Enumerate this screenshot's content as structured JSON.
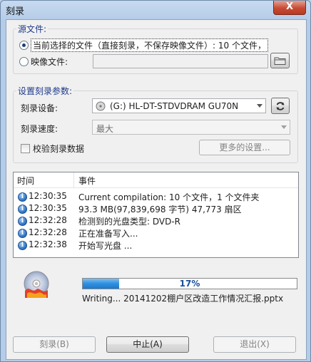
{
  "window": {
    "title": "刻录",
    "close_label": "X"
  },
  "source_group": {
    "title": "源文件:",
    "option_current_label": "当前选择的文件（直接刻录，不保存映像文件）: 10 个文件，",
    "option_image_label": "映像文件:",
    "image_path_value": ""
  },
  "params_group": {
    "title": "设置刻录参数:",
    "device_label": "刻录设备:",
    "device_value": "(G:) HL-DT-STDVDRAM GU70N",
    "speed_label": "刻录速度:",
    "speed_value": "最大",
    "verify_label": "校验刻录数据",
    "more_settings_label": "更多的设置..."
  },
  "log": {
    "columns": [
      "时间",
      "事件"
    ],
    "rows": [
      {
        "time": "12:30:35",
        "event": "Current compilation: 10 个文件，1 个文件夹"
      },
      {
        "time": "12:30:35",
        "event": "93.3 MB(97,839,698 字节)  47,773 扇区"
      },
      {
        "time": "12:32:28",
        "event": "检测到的光盘类型:  DVD-R"
      },
      {
        "time": "12:32:28",
        "event": "正在准备写入..."
      },
      {
        "time": "12:32:38",
        "event": "开始写光盘 ..."
      }
    ]
  },
  "progress": {
    "value": 0.17,
    "label": "17%",
    "status_text": "Writing... 20141202棚户区改造工作情况汇报.pptx"
  },
  "buttons": {
    "burn": "刻录(B)",
    "abort": "中止(A)",
    "exit": "退出(X)"
  },
  "icons": {
    "close": "close-icon",
    "folder": "folder-icon",
    "refresh": "refresh-icon",
    "disc": "disc-icon",
    "info": "info-icon",
    "drive": "optical-drive-icon"
  }
}
